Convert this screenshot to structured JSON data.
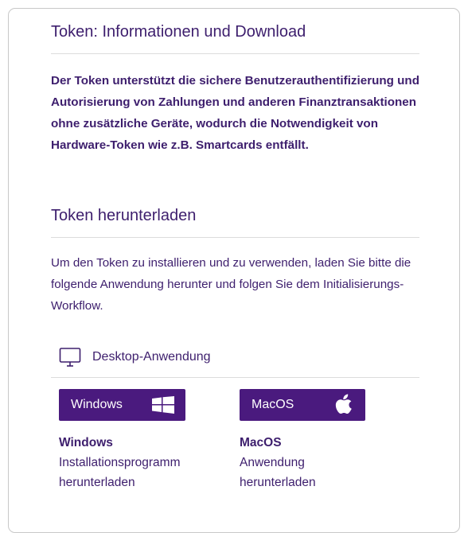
{
  "info_section": {
    "heading": "Token: Informationen und Download",
    "intro": "Der Token unterstützt die sichere Benutzerauthentifizierung und Autorisierung von Zahlungen und anderen Finanztransaktionen ohne zusätzliche Geräte, wodurch die Notwendigkeit von Hardware-Token wie z.B. Smartcards entfällt."
  },
  "download_section": {
    "heading": "Token herunterladen",
    "description": "Um den Token zu installieren und zu verwenden, laden Sie bitte die folgende Anwendung herunter und folgen Sie dem Initialisierungs-Workflow.",
    "desktop": {
      "label": "Desktop-Anwendung",
      "icon": "monitor-icon"
    },
    "windows": {
      "button_label": "Windows",
      "icon": "windows-logo-icon",
      "title": "Windows",
      "subtitle": "Installationsprogramm herunterladen"
    },
    "macos": {
      "button_label": "MacOS",
      "icon": "apple-logo-icon",
      "title": "MacOS",
      "subtitle": "Anwendung herunterladen"
    }
  },
  "colors": {
    "text": "#3d1e6d",
    "button_bg": "#4a1a7e",
    "divider": "#dcdcdc",
    "card_border": "#c8c8c8"
  }
}
